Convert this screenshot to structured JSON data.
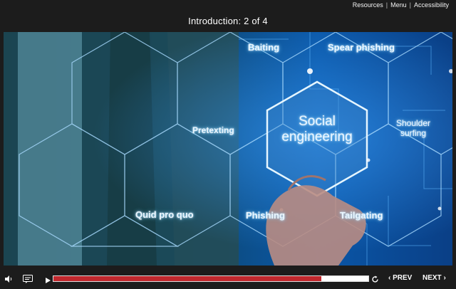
{
  "top_nav": {
    "resources": "Resources",
    "menu": "Menu",
    "accessibility": "Accessibility"
  },
  "slide": {
    "title": "Introduction: 2 of 4"
  },
  "graphic": {
    "center_label_line1": "Social",
    "center_label_line2": "engineering",
    "labels": {
      "baiting": "Baiting",
      "spear_phishing": "Spear phishing",
      "pretexting": "Pretexting",
      "shoulder_line1": "Shoulder",
      "shoulder_line2": "surfing",
      "quid_pro_quo": "Quid pro quo",
      "phishing": "Phishing",
      "tailgating": "Tailgating"
    }
  },
  "player": {
    "progress": 0.85,
    "prev_label": "PREV",
    "next_label": "NEXT",
    "colors": {
      "progress_fill": "#c1272d",
      "bar_bg": "#1c1c1c"
    },
    "icons": [
      "volume-icon",
      "captions-icon",
      "play-icon",
      "replay-icon",
      "chevron-left-icon",
      "chevron-right-icon"
    ]
  }
}
